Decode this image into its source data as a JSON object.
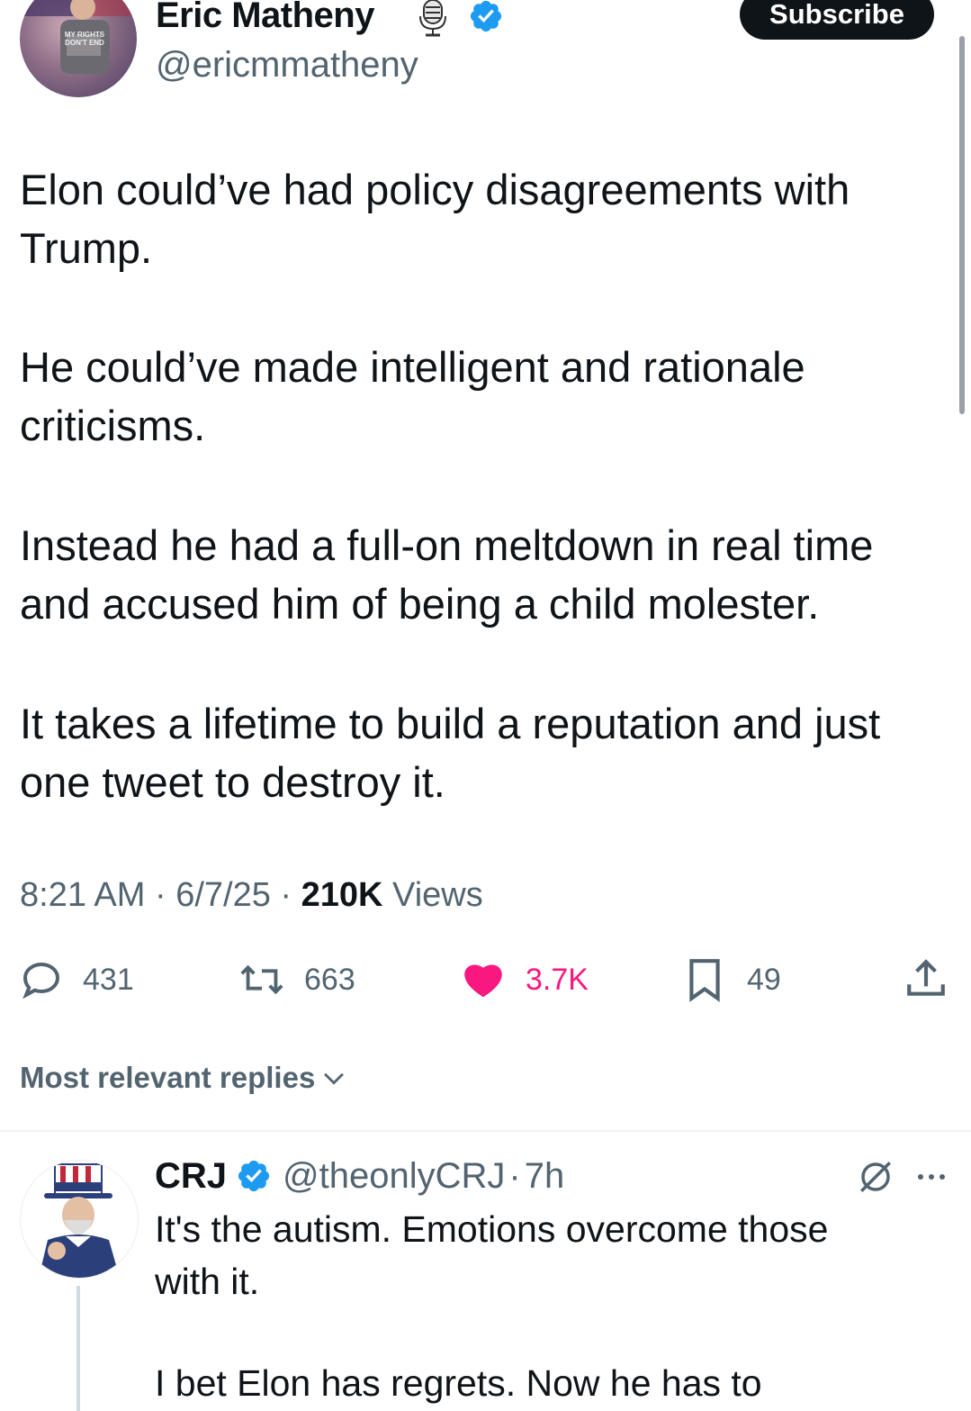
{
  "tweet": {
    "author_name": "Eric Matheny",
    "author_handle": "@ericmmatheny",
    "subscribe_label": "Subscribe",
    "paragraphs": [
      "Elon could’ve had policy disagreements with Trump.",
      "He could’ve made intelligent and rationale criticisms.",
      "Instead he had a full-on meltdown in real time and accused him of being a child molester.",
      "It takes a lifetime to build a reputation and just one tweet to destroy it."
    ],
    "time": "8:21 AM",
    "date": "6/7/25",
    "views_count": "210K",
    "views_label": "Views",
    "avatar_text": "MY RIGHTS DON'T END"
  },
  "actions": {
    "replies": "431",
    "reposts": "663",
    "likes": "3.7K",
    "bookmarks": "49"
  },
  "replies_sort": {
    "label": "Most relevant replies"
  },
  "reply": {
    "name": "CRJ",
    "handle": "@theonlyCRJ",
    "time": "7h",
    "text_lines": [
      "It's the autism.  Emotions overcome those",
      "with it.",
      "I bet Elon has regrets.  Now he has to"
    ]
  },
  "colors": {
    "verified": "#1d9bf0",
    "like": "#f91880",
    "muted": "#536471"
  },
  "icons": [
    "microphone-icon",
    "verified-badge-icon",
    "reply-icon",
    "repost-icon",
    "like-icon",
    "bookmark-icon",
    "share-icon",
    "chevron-down-icon",
    "grok-icon",
    "more-icon"
  ]
}
